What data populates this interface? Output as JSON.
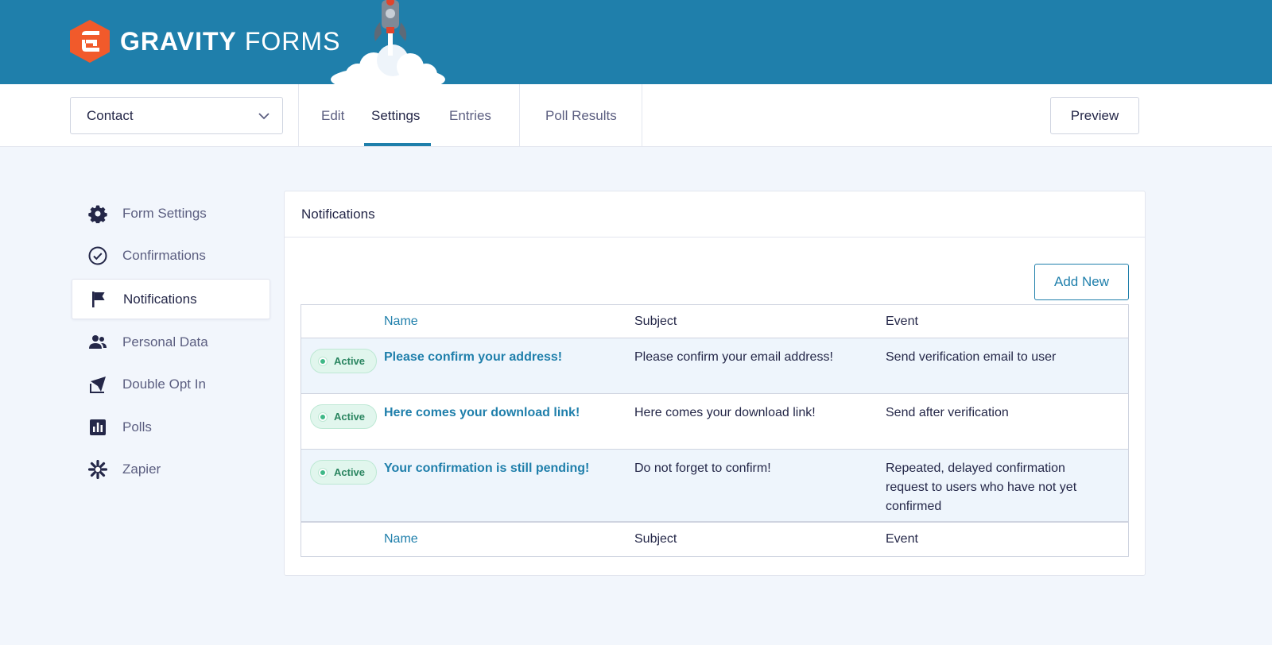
{
  "header": {
    "brand_bold": "GRAVITY",
    "brand_light": "FORMS",
    "colors": {
      "brand_bar": "#1f7fab",
      "logo_orange": "#f15a2b"
    }
  },
  "toolbar": {
    "form_select_value": "Contact",
    "tabs": [
      {
        "label": "Edit"
      },
      {
        "label": "Settings"
      },
      {
        "label": "Entries"
      },
      {
        "label": "Poll Results"
      }
    ],
    "preview_label": "Preview"
  },
  "sidebar": {
    "items": [
      {
        "label": "Form Settings",
        "icon": "gear-icon"
      },
      {
        "label": "Confirmations",
        "icon": "check-circle-icon"
      },
      {
        "label": "Notifications",
        "icon": "flag-icon"
      },
      {
        "label": "Personal Data",
        "icon": "users-icon"
      },
      {
        "label": "Double Opt In",
        "icon": "send-icon"
      },
      {
        "label": "Polls",
        "icon": "bar-chart-icon"
      },
      {
        "label": "Zapier",
        "icon": "zapier-icon"
      }
    ],
    "active": "Notifications"
  },
  "panel": {
    "title": "Notifications",
    "add_new_label": "Add New",
    "table": {
      "columns": [
        "Name",
        "Subject",
        "Event"
      ],
      "rows": [
        {
          "status": "Active",
          "name": "Please confirm your address!",
          "subject": "Please confirm your email address!",
          "event": "Send verification email to user"
        },
        {
          "status": "Active",
          "name": "Here comes your download link!",
          "subject": "Here comes your download link!",
          "event": "Send after verification"
        },
        {
          "status": "Active",
          "name": "Your confirmation is still pending!",
          "subject": "Do not forget to confirm!",
          "event": "Repeated, delayed confirmation request to users who have not yet confirmed"
        }
      ]
    }
  }
}
